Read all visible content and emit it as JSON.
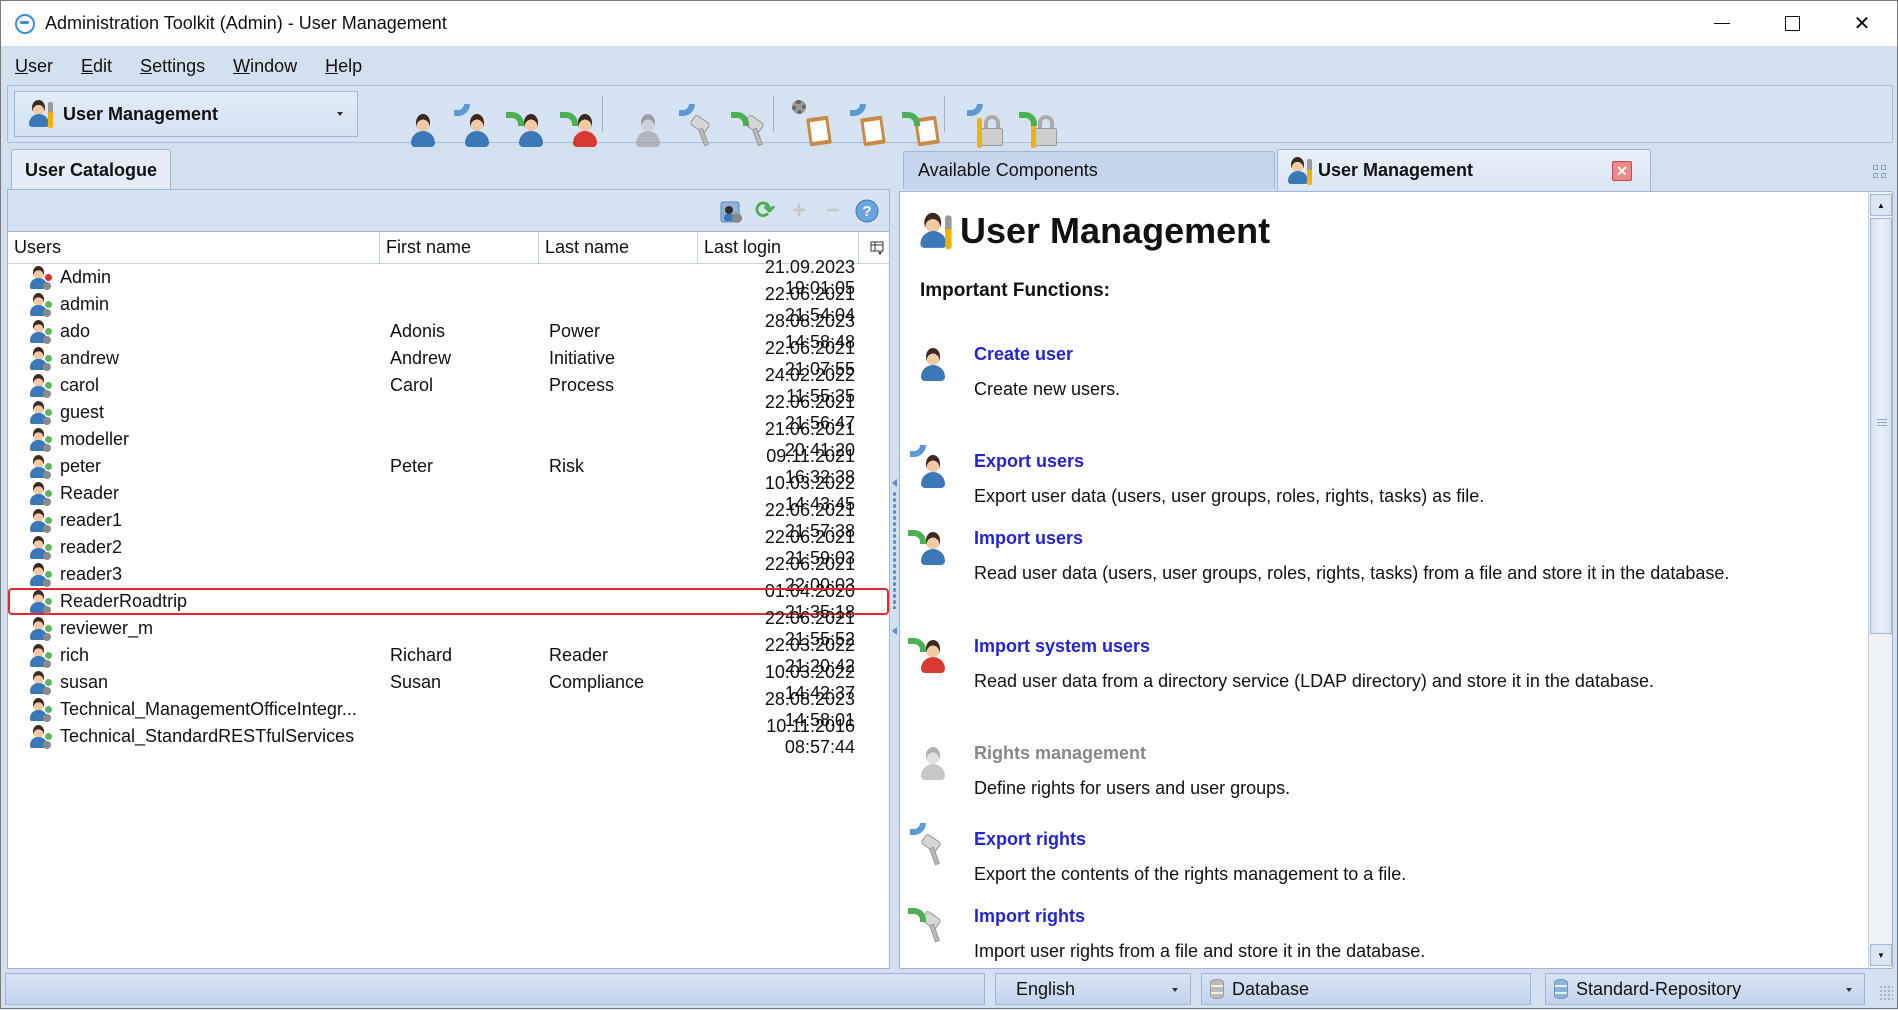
{
  "window": {
    "title": "Administration Toolkit (Admin) - User Management",
    "controls": [
      "minimize",
      "maximize",
      "close"
    ]
  },
  "menu": [
    {
      "label": "User",
      "mnemonic": "U"
    },
    {
      "label": "Edit",
      "mnemonic": "E"
    },
    {
      "label": "Settings",
      "mnemonic": "S"
    },
    {
      "label": "Window",
      "mnemonic": "W"
    },
    {
      "label": "Help",
      "mnemonic": "H"
    }
  ],
  "toolbar": {
    "perspective_selected": "User Management",
    "buttons": [
      {
        "icon": "create-user-icon",
        "group": 1
      },
      {
        "icon": "export-users-icon",
        "group": 1
      },
      {
        "icon": "import-users-icon",
        "group": 1
      },
      {
        "icon": "import-system-users-icon",
        "group": 1
      },
      {
        "icon": "rights-management-icon",
        "group": 2,
        "disabled": true
      },
      {
        "icon": "export-rights-icon",
        "group": 2
      },
      {
        "icon": "import-rights-icon",
        "group": 2
      },
      {
        "icon": "config-settings-icon",
        "group": 3
      },
      {
        "icon": "export-config-icon",
        "group": 3
      },
      {
        "icon": "import-config-icon",
        "group": 3
      },
      {
        "icon": "export-security-icon",
        "group": 4
      },
      {
        "icon": "import-security-icon",
        "group": 4
      }
    ]
  },
  "left": {
    "tab": "User Catalogue",
    "list_toolbar_icons": [
      "user-properties-icon",
      "refresh-icon",
      "add-icon",
      "remove-icon",
      "help-icon"
    ],
    "columns": [
      "Users",
      "First name",
      "Last name",
      "Last login"
    ],
    "rows": [
      {
        "user": "Admin",
        "first": "",
        "last": "",
        "login": "21.09.2023 19:01:05",
        "status": "red"
      },
      {
        "user": "admin",
        "first": "",
        "last": "",
        "login": "22.06.2021 21:54:04",
        "status": "green"
      },
      {
        "user": "ado",
        "first": "Adonis",
        "last": "Power",
        "login": "28.08.2023 14:58:48",
        "status": "green"
      },
      {
        "user": "andrew",
        "first": "Andrew",
        "last": "Initiative",
        "login": "22.06.2021 21:07:55",
        "status": "green"
      },
      {
        "user": "carol",
        "first": "Carol",
        "last": "Process",
        "login": "24.02.2022 11:55:35",
        "status": "green"
      },
      {
        "user": "guest",
        "first": "",
        "last": "",
        "login": "22.06.2021 21:56:47",
        "status": "green"
      },
      {
        "user": "modeller",
        "first": "",
        "last": "",
        "login": "21.06.2021 20:41:20",
        "status": "green"
      },
      {
        "user": "peter",
        "first": "Peter",
        "last": "Risk",
        "login": "09.11.2021 16:32:38",
        "status": "green"
      },
      {
        "user": "Reader",
        "first": "",
        "last": "",
        "login": "10.03.2022 14:43:45",
        "status": "green"
      },
      {
        "user": "reader1",
        "first": "",
        "last": "",
        "login": "22.06.2021 21:57:38",
        "status": "green"
      },
      {
        "user": "reader2",
        "first": "",
        "last": "",
        "login": "22.06.2021 21:59:03",
        "status": "green"
      },
      {
        "user": "reader3",
        "first": "",
        "last": "",
        "login": "22.06.2021 22:00:03",
        "status": "green"
      },
      {
        "user": "ReaderRoadtrip",
        "first": "",
        "last": "",
        "login": "01.04.2020 21:35:18",
        "status": "green",
        "selected": true
      },
      {
        "user": "reviewer_m",
        "first": "",
        "last": "",
        "login": "22.06.2021 21:55:52",
        "status": "green"
      },
      {
        "user": "rich",
        "first": "Richard",
        "last": "Reader",
        "login": "22.03.2022 21:20:42",
        "status": "green"
      },
      {
        "user": "susan",
        "first": "Susan",
        "last": "Compliance",
        "login": "10.03.2022 14:42:37",
        "status": "green"
      },
      {
        "user": "Technical_ManagementOfficeIntegr...",
        "first": "",
        "last": "",
        "login": "28.08.2023 14:58:01",
        "status": "green"
      },
      {
        "user": "Technical_StandardRESTfulServices",
        "first": "",
        "last": "",
        "login": "10.11.2016 08:57:44",
        "status": "green"
      }
    ]
  },
  "right": {
    "tabs": [
      {
        "label": "Available Components",
        "active": false
      },
      {
        "label": "User Management",
        "active": true,
        "closable": true
      }
    ],
    "page_title": "User Management",
    "section_heading": "Important Functions:",
    "functions": [
      {
        "title": "Create user",
        "desc": "Create new users.",
        "icon": "create-user-icon",
        "enabled": true
      },
      {
        "title": "Export users",
        "desc": "Export user data (users, user groups, roles, rights, tasks) as file.",
        "icon": "export-users-icon",
        "enabled": true
      },
      {
        "title": "Import users",
        "desc": "Read user data (users, user groups, roles, rights, tasks) from a file and store it in the database.",
        "icon": "import-users-icon",
        "enabled": true
      },
      {
        "title": "Import system users",
        "desc": "Read user data from a directory service (LDAP directory) and store it in the database.",
        "icon": "import-system-users-icon",
        "enabled": true
      },
      {
        "title": "Rights management",
        "desc": "Define rights for users and user groups.",
        "icon": "rights-management-icon",
        "enabled": false
      },
      {
        "title": "Export rights",
        "desc": "Export the contents of the rights management to a file.",
        "icon": "export-rights-icon",
        "enabled": true
      },
      {
        "title": "Import rights",
        "desc": "Import user rights from a file and store it in the database.",
        "icon": "import-rights-icon",
        "enabled": true
      }
    ]
  },
  "status": {
    "message": "",
    "language": "English",
    "database": "Database",
    "repository": "Standard-Repository"
  }
}
